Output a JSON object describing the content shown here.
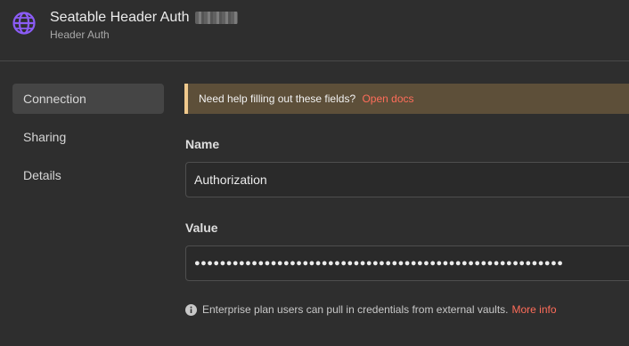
{
  "header": {
    "title": "Seatable Header Auth",
    "subtitle": "Header Auth",
    "icon": "globe-icon"
  },
  "sidebar": {
    "items": [
      {
        "label": "Connection",
        "active": true
      },
      {
        "label": "Sharing",
        "active": false
      },
      {
        "label": "Details",
        "active": false
      }
    ]
  },
  "notice": {
    "text": "Need help filling out these fields?",
    "link": "Open docs"
  },
  "form": {
    "name_label": "Name",
    "name_value": "Authorization",
    "value_label": "Value",
    "value_masked": "●●●●●●●●●●●●●●●●●●●●●●●●●●●●●●●●●●●●●●●●●●●●●●●●●●●●●●●●●●"
  },
  "info": {
    "text": "Enterprise plan users can pull in credentials from external vaults.",
    "link": "More info",
    "icon": "info-icon"
  },
  "colors": {
    "background": "#2e2e2e",
    "accent_link": "#ff6d5a",
    "globe": "#8b5cf6",
    "notice_bg": "#5d4f39",
    "notice_border": "#f0c98d"
  }
}
